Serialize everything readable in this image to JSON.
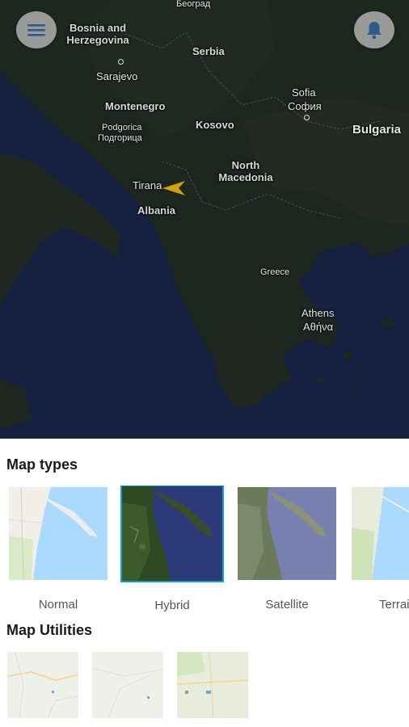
{
  "map": {
    "labels": {
      "beograd": "Београд",
      "bosnia": "Bosnia and Herzegovina",
      "serbia": "Serbia",
      "sarajevo": "Sarajevo",
      "sofia": "Sofia",
      "sofia_cyr": "София",
      "montenegro": "Montenegro",
      "podgorica": "Podgorica",
      "podgorica_cyr": "Подгорица",
      "kosovo": "Kosovo",
      "bulgaria": "Bulgaria",
      "north_macedonia": "North Macedonia",
      "tirana": "Tirana",
      "albania": "Albania",
      "greece": "Greece",
      "athens": "Athens",
      "athens_gr": "Αθήνα"
    }
  },
  "buttons": {
    "menu_icon": "hamburger-menu-icon",
    "notifications_icon": "bell-icon"
  },
  "map_types": {
    "title": "Map types",
    "items": [
      {
        "label": "Normal",
        "selected": false
      },
      {
        "label": "Hybrid",
        "selected": true
      },
      {
        "label": "Satellite",
        "selected": false
      },
      {
        "label": "Terrain",
        "selected": false
      }
    ]
  },
  "map_utilities": {
    "title": "Map Utilities"
  },
  "colors": {
    "selected_border": "#0fa3c9",
    "marker": "#f2b705",
    "fab_bg": "#d9d9d9",
    "icon": "#2f5a8a"
  }
}
